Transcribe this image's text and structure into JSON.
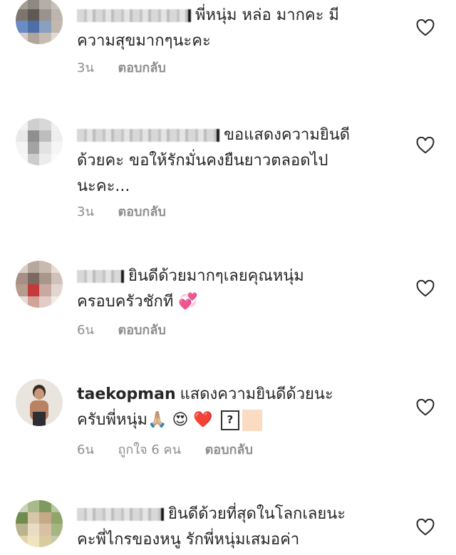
{
  "comments": [
    {
      "text_line1": "พี่หนุ่ม หล่อ มากคะ มี",
      "text_line2": "ความสุขมากๆนะคะ",
      "time": "3น",
      "reply": "ตอบกลับ"
    },
    {
      "text_line1": "ขอแสดงความยินดี",
      "text_line2": "ด้วยคะ ขอให้รักมั่นคงยืนยาวตลอดไป",
      "text_line3": "นะคะ...",
      "time": "3น",
      "reply": "ตอบกลับ"
    },
    {
      "text_line1": "ยินดีด้วยมากๆเลยคุณหนุ่ม",
      "text_line2": "ครอบครัวชักที",
      "emoji": "💞",
      "time": "6น",
      "reply": "ตอบกลับ"
    },
    {
      "username": "taekopman",
      "text_line1": "แสดงความยินดีด้วยนะ",
      "text_line2": "ครับพี่หนุ่ม",
      "emojis": [
        "🙏🏼",
        "😍",
        "❤️"
      ],
      "unknown_glyph": "?",
      "time": "6น",
      "likes": "ถูกใจ 6 คน",
      "reply": "ตอบกลับ"
    },
    {
      "text_line1": "ยินดีด้วยที่สุดในโลกเลยนะ",
      "text_line2": "คะพี่ไกรของหนู รักพี่หนุ่มเสมอค่า"
    }
  ],
  "icons": {
    "like": "heart-outline-icon"
  },
  "colors": {
    "text": "#262626",
    "meta": "#8e8e8e",
    "heart_stroke": "#262626"
  }
}
